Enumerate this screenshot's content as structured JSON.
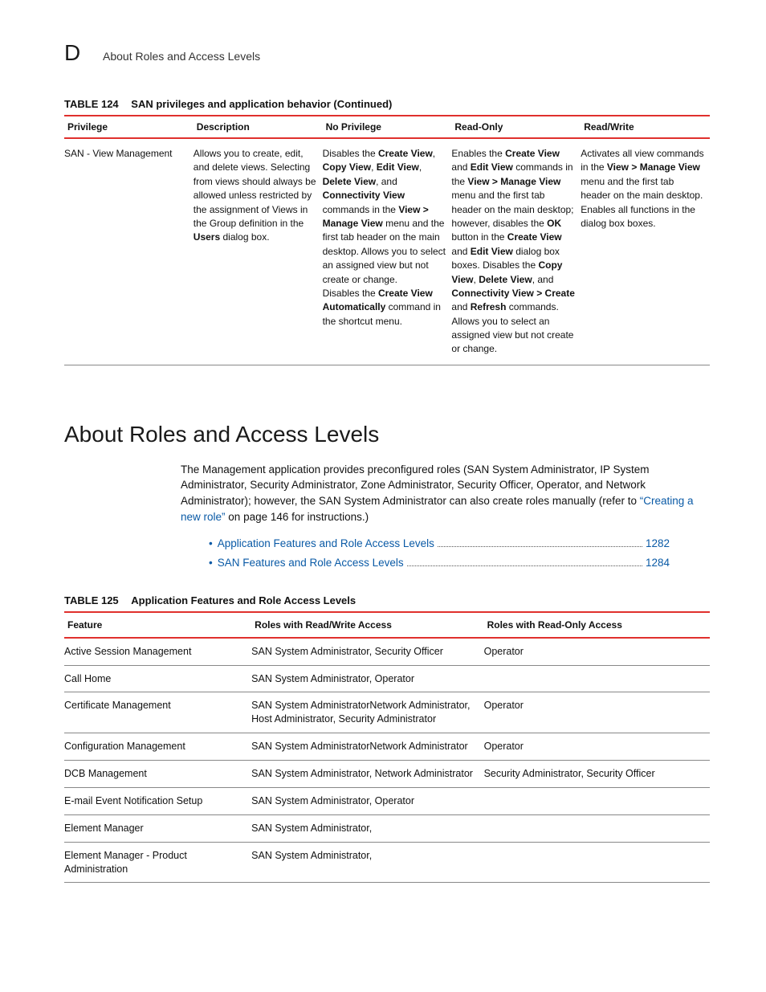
{
  "header": {
    "letter": "D",
    "title": "About Roles and Access Levels"
  },
  "table124": {
    "caption_num": "TABLE 124",
    "caption_txt": "SAN privileges and application behavior (Continued)",
    "headers": [
      "Privilege",
      "Description",
      "No Privilege",
      "Read-Only",
      "Read/Write"
    ],
    "row": {
      "privilege": "SAN - View Management",
      "description_html": "Allows you to create, edit, and delete views. Selecting from views should always be allowed unless restricted by the assignment of Views in the Group definition in the <b>Users</b> dialog box.",
      "no_priv_html": "Disables the <b>Create View</b>, <b>Copy View</b>, <b>Edit View</b>, <b>Delete View</b>, and <b>Connectivity View</b> commands in the <b>View &gt; Manage View</b> menu and the first tab header on the main desktop. Allows you to select an assigned view but not create or change.<br>Disables the <b>Create View Automatically</b> command in the shortcut menu.",
      "read_only_html": "Enables the <b>Create View</b> and <b>Edit View</b> commands in the <b>View &gt; Manage View</b> menu and the first tab header on the main desktop; however, disables the <b>OK</b> button in the <b>Create View</b> and <b>Edit View</b> dialog box boxes. Disables the <b>Copy View</b>, <b>Delete View</b>, and <b>Connectivity View &gt; Create</b> and <b>Refresh</b> commands.<br>Allows you to select an assigned view but not create or change.",
      "read_write_html": "Activates all view commands in the <b>View &gt; Manage View</b> menu and the first tab header on the main desktop. Enables all functions in the dialog box boxes."
    }
  },
  "section_heading": "About Roles and Access Levels",
  "body_paragraph": {
    "before_link": "The Management application provides preconfigured roles (SAN System Administrator, IP System Administrator, Security Administrator, Zone Administrator, Security Officer, Operator, and Network Administrator); however, the SAN System Administrator  can also create roles manually (refer to ",
    "link_text": "“Creating a new role”",
    "after_link": " on page 146 for instructions.)"
  },
  "toc": [
    {
      "label": "Application Features and Role Access Levels",
      "page": "1282"
    },
    {
      "label": "SAN Features and Role Access Levels",
      "page": "1284"
    }
  ],
  "table125": {
    "caption_num": "TABLE 125",
    "caption_txt": "Application Features and Role Access Levels",
    "headers": [
      "Feature",
      "Roles with Read/Write Access",
      "Roles with Read-Only Access"
    ],
    "rows": [
      {
        "feature": "Active Session Management",
        "rw": "SAN System Administrator, Security Officer",
        "ro": "Operator"
      },
      {
        "feature": "Call Home",
        "rw": "SAN System Administrator, Operator",
        "ro": ""
      },
      {
        "feature": "Certificate Management",
        "rw": "SAN System AdministratorNetwork Administrator, Host Administrator, Security Administrator",
        "ro": "Operator"
      },
      {
        "feature": "Configuration Management",
        "rw": "SAN System AdministratorNetwork Administrator",
        "ro": "Operator"
      },
      {
        "feature": "DCB Management",
        "rw": "SAN System Administrator, Network Administrator",
        "ro": "Security Administrator, Security Officer"
      },
      {
        "feature": "E-mail Event Notification Setup",
        "rw": "SAN System Administrator, Operator",
        "ro": ""
      },
      {
        "feature": "Element Manager",
        "rw": "SAN System Administrator,",
        "ro": ""
      },
      {
        "feature": "Element Manager - Product Administration",
        "rw": "SAN System Administrator,",
        "ro": ""
      }
    ]
  }
}
